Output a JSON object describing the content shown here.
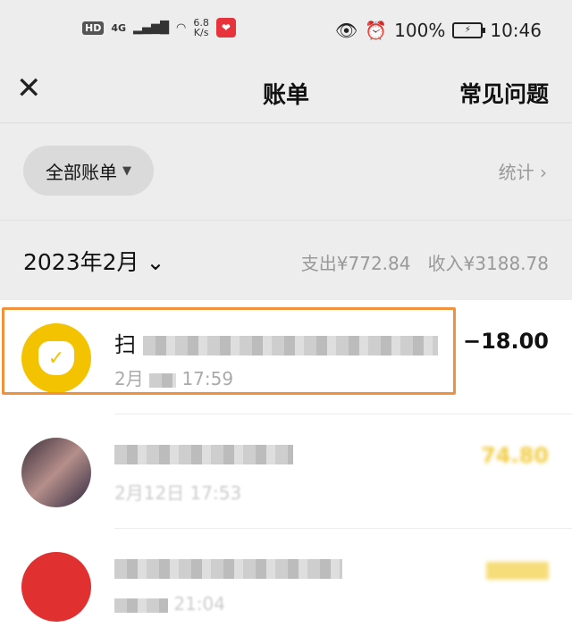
{
  "status_bar": {
    "hd": "HD",
    "net_type": "4G",
    "speed_value": "6.8",
    "speed_unit": "K/s",
    "battery": "100%",
    "time": "10:46"
  },
  "header": {
    "close_icon": "close-icon",
    "title": "账单",
    "faq_label": "常见问题"
  },
  "filter": {
    "label": "全部账单",
    "stats_label": "统计 ›"
  },
  "summary": {
    "month": "2023年2月",
    "expense": "支出¥772.84",
    "income": "收入¥3188.78"
  },
  "transactions": [
    {
      "name": "扫",
      "time_prefix": "2月",
      "time_suffix": "17:59",
      "amount": "−18.00",
      "icon": "money-bag-icon"
    },
    {
      "name": "",
      "time": "2月12日 17:53",
      "amount": "74.80",
      "icon": "avatar"
    },
    {
      "name": "",
      "time": "21:04",
      "amount": "",
      "icon": "avatar"
    }
  ],
  "colors": {
    "accent_yellow": "#f3c200",
    "highlight": "#f0913c"
  }
}
